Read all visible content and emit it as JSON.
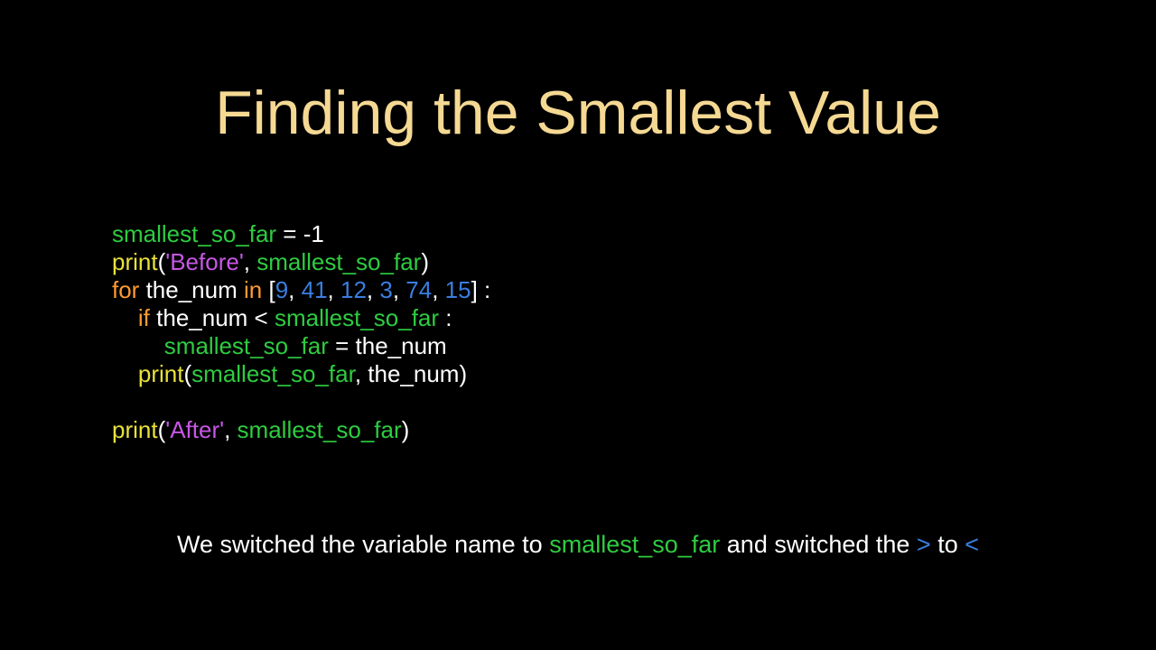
{
  "title": "Finding the Smallest Value",
  "code": {
    "l1a": "smallest_so_far",
    "l1b": " = ",
    "l1c": "-1",
    "l2a": "print",
    "l2b": "(",
    "l2c": "'Before'",
    "l2d": ", ",
    "l2e": "smallest_so_far",
    "l2f": ")",
    "l3a": "for",
    "l3b": " the_num ",
    "l3c": "in",
    "l3d": " [",
    "l3e": "9",
    "l3f": ", ",
    "l3g": "41",
    "l3h": ", ",
    "l3i": "12",
    "l3j": ", ",
    "l3k": "3",
    "l3l": ", ",
    "l3m": "74",
    "l3n": ", ",
    "l3o": "15",
    "l3p": "] :",
    "l4a": "    ",
    "l4b": "if",
    "l4c": " the_num < ",
    "l4d": "smallest_so_far",
    "l4e": " :",
    "l5a": "        ",
    "l5b": "smallest_so_far",
    "l5c": " = the_num",
    "l6a": "    ",
    "l6b": "print",
    "l6c": "(",
    "l6d": "smallest_so_far",
    "l6e": ", the_num)",
    "blank": "",
    "l8a": "print",
    "l8b": "(",
    "l8c": "'After'",
    "l8d": ", ",
    "l8e": "smallest_so_far",
    "l8f": ")"
  },
  "caption": {
    "t1": "We switched the variable name to ",
    "t2": "smallest_so_far",
    "t3": " and switched the ",
    "t4": ">",
    "t5": " to ",
    "t6": "<"
  }
}
